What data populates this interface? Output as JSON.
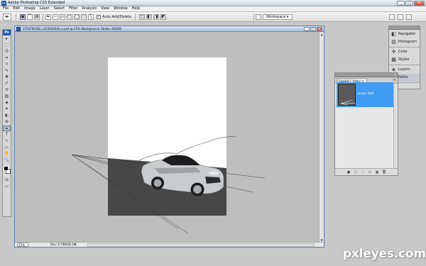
{
  "window": {
    "title": "Adobe Photoshop CS3 Extended",
    "app_icon": "Ps",
    "minimize": "_",
    "maximize": "□",
    "close": "✕"
  },
  "menu": [
    "File",
    "Edit",
    "Image",
    "Layer",
    "Select",
    "Filter",
    "Analysis",
    "View",
    "Window",
    "Help"
  ],
  "options_bar": {
    "tool_icon": "pen-tool-icon",
    "auto_add_delete_label": "Auto Add/Delete",
    "auto_add_delete_checked": true,
    "workspace_label": "Workspace ▾"
  },
  "tools_panel": {
    "header": "Ps",
    "tools": [
      "▸",
      "⬚",
      "ʘ",
      "⌗",
      "⌑",
      "✎",
      "✚",
      "✐",
      "⊘",
      "▤",
      "◈",
      "✦",
      "◐",
      "⊕",
      "✒",
      "T",
      "↖",
      "▭",
      "✋",
      "🔍"
    ],
    "selected_tool_index": 14
  },
  "document": {
    "title": "3754792582_c43395450d_o.psd @ 25% (Background, Stroke, RGB/8)",
    "zoom": "25%",
    "doc_info": "Doc: 9.76M/36.1M",
    "info_arrow": "▸",
    "scroll_up": "▲",
    "scroll_down": "▼"
  },
  "dock": {
    "groups": [
      {
        "items": [
          {
            "icon": "navigator-icon",
            "label": "Navigator"
          },
          {
            "icon": "histogram-icon",
            "label": "Histogram"
          }
        ]
      },
      {
        "items": [
          {
            "icon": "color-icon",
            "label": "Color"
          },
          {
            "icon": "styles-icon",
            "label": "Styles"
          }
        ]
      },
      {
        "items": [
          {
            "icon": "layers-icon",
            "label": "Layers"
          },
          {
            "icon": "paths-icon",
            "label": "Paths",
            "selected": true
          }
        ]
      }
    ]
  },
  "paths_panel": {
    "tabs": [
      "Layers",
      "Paths ×"
    ],
    "active_tab": "Paths ×",
    "menu_icon": "≡",
    "close": "×",
    "path_name": "Linear Path",
    "footer_buttons": [
      "●",
      "○",
      "◌",
      "◇",
      "▣",
      "🗑"
    ]
  },
  "watermark": "pxleyes.com",
  "colors": {
    "accent_blue": "#3f9cf2",
    "canvas_dark": "#474747",
    "canvas_white": "#ffffff",
    "workspace_gray": "#bebebe"
  }
}
